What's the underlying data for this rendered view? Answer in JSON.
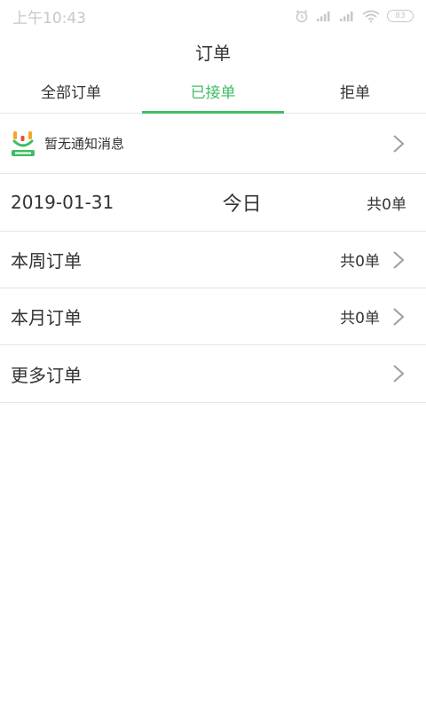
{
  "status_bar": {
    "time": "上午10:43",
    "battery": "83",
    "icons": [
      "alarm-icon",
      "signal-icon",
      "signal-icon",
      "wifi-icon",
      "battery-icon"
    ]
  },
  "header": {
    "title": "订单"
  },
  "tabs": [
    {
      "label": "全部订单",
      "active": false
    },
    {
      "label": "已接单",
      "active": true
    },
    {
      "label": "拒单",
      "active": false
    }
  ],
  "notice": {
    "icon": "merchant-logo-icon",
    "text": "暂无通知消息"
  },
  "today": {
    "date": "2019-01-31",
    "label": "今日",
    "count": "共0单"
  },
  "rows": [
    {
      "label": "本周订单",
      "count": "共0单"
    },
    {
      "label": "本月订单",
      "count": "共0单"
    },
    {
      "label": "更多订单",
      "count": ""
    }
  ],
  "colors": {
    "accent": "#3ebd63",
    "text": "#333333",
    "divider": "#e5e5e5",
    "status": "#c7c7c7"
  }
}
